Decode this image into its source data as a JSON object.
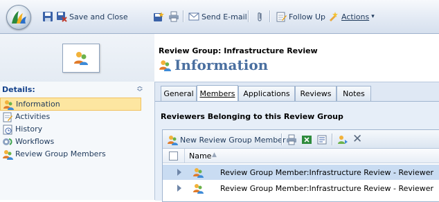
{
  "toolbar": {
    "save_close": "Save and Close",
    "send_email": "Send E-mail",
    "follow_up": "Follow Up",
    "actions": "Actions"
  },
  "nav": {
    "header": "Details:",
    "items": [
      "Information",
      "Activities",
      "History",
      "Workflows",
      "Review Group Members"
    ],
    "selected_index": 0
  },
  "header": {
    "breadcrumb": "Review Group: Infrastructure Review",
    "title": "Information"
  },
  "tabs": [
    "General",
    "Members",
    "Applications",
    "Reviews",
    "Notes"
  ],
  "active_tab": "Members",
  "section": {
    "title": "Reviewers Belonging to this Review Group",
    "new_button": "New Review Group Member",
    "column_name": "Name",
    "rows": [
      "Review Group Member:Infrastructure Review - Reviewer",
      "Review Group Member:Infrastructure Review - Reviewer"
    ]
  },
  "colors": {
    "accent": "#15428b",
    "title": "#4a6fa0",
    "selection": "#fde6a1"
  }
}
